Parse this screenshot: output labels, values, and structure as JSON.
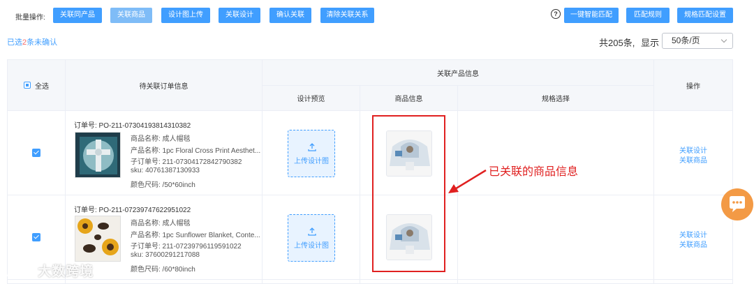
{
  "toolbar": {
    "label": "批量操作:",
    "buttons": [
      "关联同产品",
      "关联商品",
      "设计图上传",
      "关联设计",
      "确认关联",
      "清除关联关系"
    ],
    "right_buttons": [
      "一键智能匹配",
      "匹配规则",
      "规格匹配设置"
    ],
    "help_glyph": "?"
  },
  "selection": {
    "prefix": "已选",
    "count": "2",
    "suffix": "条未确认"
  },
  "pagination": {
    "total": "共205条,",
    "show_label": "显示",
    "page_size": "50条/页"
  },
  "table": {
    "select_all": "全选",
    "col_order": "待关联订单信息",
    "col_group": "关联产品信息",
    "col_design": "设计预览",
    "col_product": "商品信息",
    "col_spec": "规格选择",
    "col_ops": "操作",
    "rows": [
      {
        "order_no": "订单号: PO-211-07304193814310382",
        "product_name": "商品名称: 成人帽毯",
        "title": "产品名称: 1pc Floral Cross Print Aesthet...",
        "sub_order": "子订单号: 211-07304172842790382",
        "sku": "sku: 40761387130933",
        "size": "颜色尺码: /50*60inch",
        "upload_label": "上传设计图",
        "ops": [
          "关联设计",
          "关联商品"
        ]
      },
      {
        "order_no": "订单号: PO-211-07239747622951022",
        "product_name": "商品名称: 成人帽毯",
        "title": "产品名称: 1pc Sunflower Blanket, Conte...",
        "sub_order": "子订单号: 211-07239796119591022",
        "sku": "sku: 37600291217088",
        "size": "颜色尺码: /60*80inch",
        "upload_label": "上传设计图",
        "ops": [
          "关联设计",
          "关联商品"
        ]
      }
    ]
  },
  "annotation": "已关联的商品信息",
  "watermark": "大数跨境",
  "colors": {
    "primary": "#409eff",
    "primary_light": "#7fbcf7",
    "annotation_red": "#e02020",
    "chat_orange": "#f39a45"
  }
}
